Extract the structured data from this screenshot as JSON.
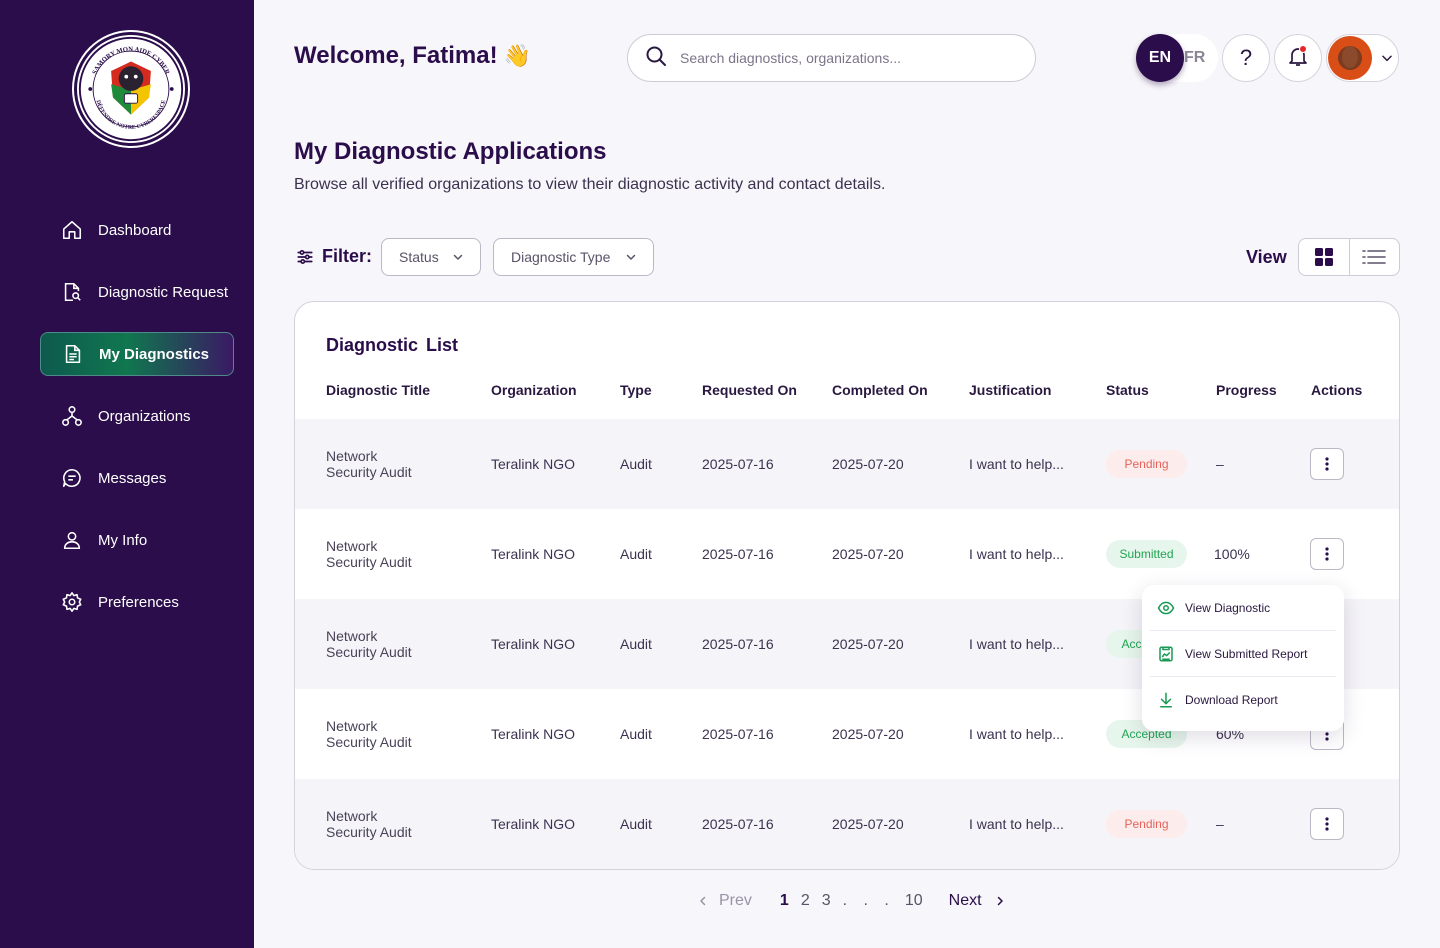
{
  "brand": {
    "logo_ring_text_top": "SAMORY MON AIDE CYBER",
    "logo_ring_text_bottom": "DÉFENDRE NOTRE CYBERESPACE",
    "colors": {
      "sidebar": "#2a0d4a",
      "accent_green": "#10774f",
      "primary": "#2a0d4a"
    }
  },
  "sidebar": {
    "items": [
      {
        "label": "Dashboard",
        "icon": "home-icon",
        "active": false
      },
      {
        "label": "Diagnostic Request",
        "icon": "document-search-icon",
        "active": false
      },
      {
        "label": "My Diagnostics",
        "icon": "document-icon",
        "active": true
      },
      {
        "label": "Organizations",
        "icon": "organization-icon",
        "active": false
      },
      {
        "label": "Messages",
        "icon": "chat-icon",
        "active": false
      },
      {
        "label": "My Info",
        "icon": "user-icon",
        "active": false
      },
      {
        "label": "Preferences",
        "icon": "gear-icon",
        "active": false
      }
    ]
  },
  "header": {
    "welcome": "Welcome, Fatima!",
    "wave": "👋",
    "search_placeholder": "Search diagnostics, organizations...",
    "lang_active": "EN",
    "lang_other": "FR",
    "help": "?"
  },
  "page": {
    "title": "My Diagnostic Applications",
    "subtitle": "Browse all verified organizations to view their diagnostic activity and contact details."
  },
  "filters": {
    "label": "Filter:",
    "status": "Status",
    "type": "Diagnostic Type",
    "view_label": "View"
  },
  "table": {
    "title": "Diagnostic  List",
    "columns": [
      "Diagnostic Title",
      "Organization",
      "Type",
      "Requested On",
      "Completed On",
      "Justification",
      "Status",
      "Progress",
      "Actions"
    ],
    "rows": [
      {
        "title_line1": "Network",
        "title_line2": "Security Audit",
        "org": "Teralink NGO",
        "type": "Audit",
        "requested": "2025-07-16",
        "completed": "2025-07-20",
        "justification": "I want to help...",
        "status": "Pending",
        "progress": "–"
      },
      {
        "title_line1": "Network",
        "title_line2": "Security Audit",
        "org": "Teralink NGO",
        "type": "Audit",
        "requested": "2025-07-16",
        "completed": "2025-07-20",
        "justification": "I want to help...",
        "status": "Submitted",
        "progress": "100%"
      },
      {
        "title_line1": "Network",
        "title_line2": "Security Audit",
        "org": "Teralink NGO",
        "type": "Audit",
        "requested": "2025-07-16",
        "completed": "2025-07-20",
        "justification": "I want to help...",
        "status": "Accepted",
        "progress": ""
      },
      {
        "title_line1": "Network",
        "title_line2": "Security Audit",
        "org": "Teralink NGO",
        "type": "Audit",
        "requested": "2025-07-16",
        "completed": "2025-07-20",
        "justification": "I want to help...",
        "status": "Accepted",
        "progress": "60%"
      },
      {
        "title_line1": "Network",
        "title_line2": "Security Audit",
        "org": "Teralink NGO",
        "type": "Audit",
        "requested": "2025-07-16",
        "completed": "2025-07-20",
        "justification": "I want to help...",
        "status": "Pending",
        "progress": "–"
      }
    ]
  },
  "action_menu": {
    "items": [
      {
        "label": "View Diagnostic",
        "icon": "eye-icon"
      },
      {
        "label": "View Submitted Report",
        "icon": "report-icon"
      },
      {
        "label": "Download Report",
        "icon": "download-icon"
      }
    ]
  },
  "pagination": {
    "prev": "Prev",
    "pages": [
      "1",
      "2",
      "3"
    ],
    "dots": ". . .",
    "last": "10",
    "current": "1",
    "next": "Next"
  }
}
